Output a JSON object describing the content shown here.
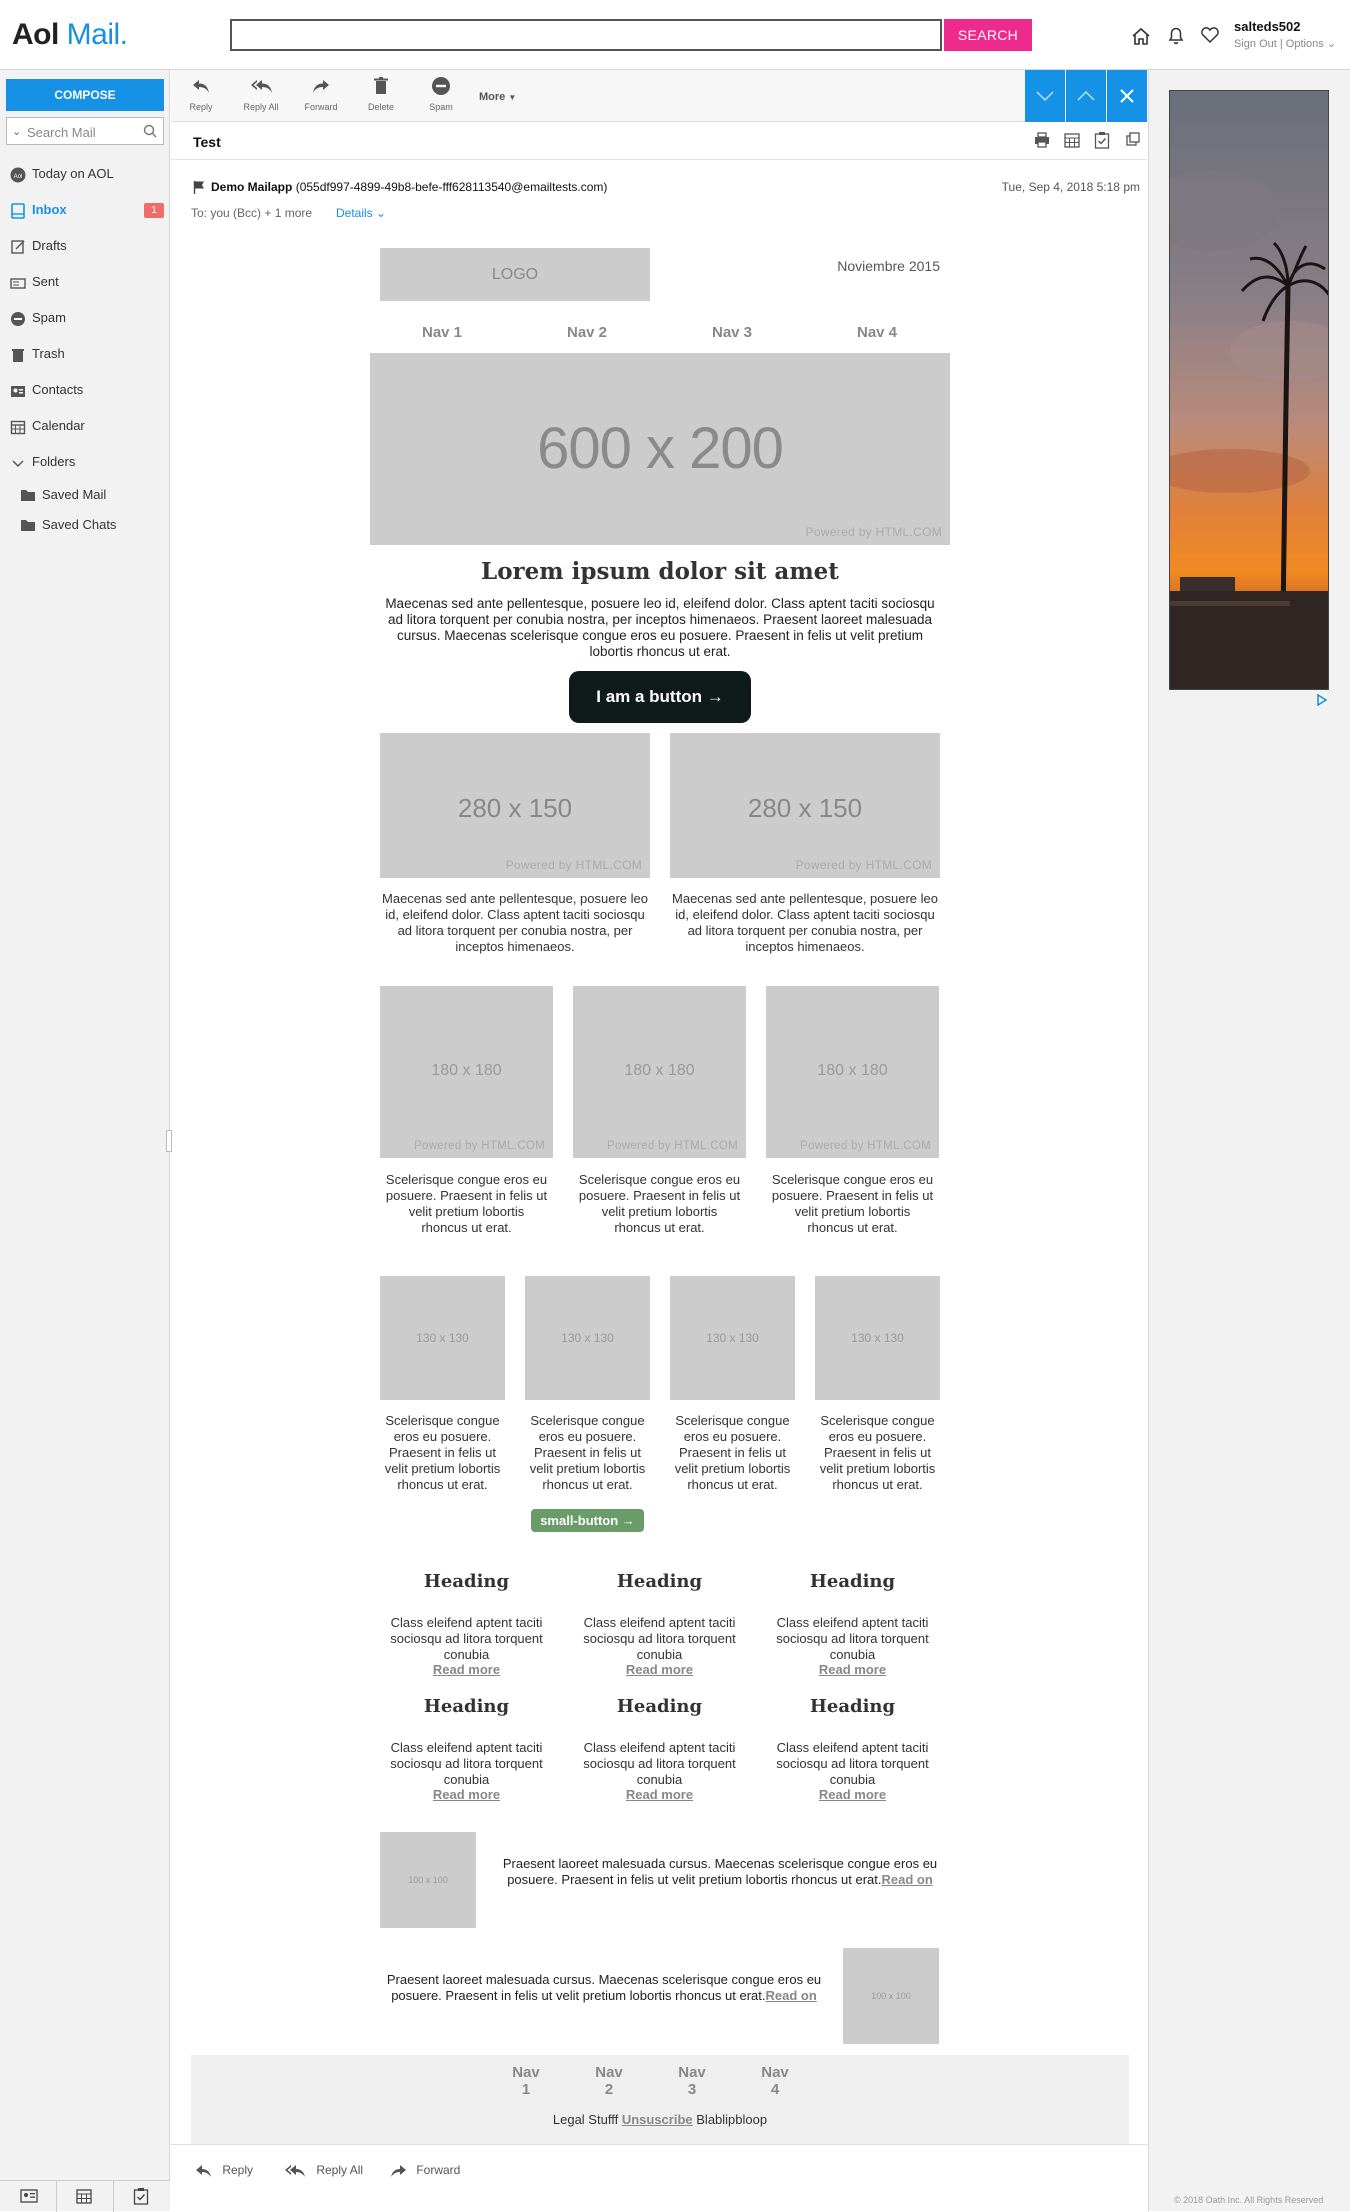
{
  "app": {
    "logo_brand": "Aol",
    "logo_product": "Mail.",
    "search_placeholder": "",
    "search_button": "SEARCH",
    "user_name": "salteds502",
    "sign_out": "Sign Out",
    "options": "Options"
  },
  "sidebar": {
    "compose": "COMPOSE",
    "search_placeholder": "Search Mail",
    "items": [
      {
        "label": "Today on AOL"
      },
      {
        "label": "Inbox",
        "badge": "1"
      },
      {
        "label": "Drafts"
      },
      {
        "label": "Sent"
      },
      {
        "label": "Spam"
      },
      {
        "label": "Trash"
      },
      {
        "label": "Contacts"
      },
      {
        "label": "Calendar"
      },
      {
        "label": "Folders"
      }
    ],
    "folders": [
      {
        "label": "Saved Mail"
      },
      {
        "label": "Saved Chats"
      }
    ]
  },
  "toolbar": {
    "reply": "Reply",
    "reply_all": "Reply All",
    "forward": "Forward",
    "delete": "Delete",
    "spam": "Spam",
    "more": "More"
  },
  "message": {
    "subject": "Test",
    "from_name": "Demo Mailapp",
    "from_address": "(055df997-4899-49b8-befe-fff628113540@emailtests.com)",
    "to": "To: you (Bcc) + 1 more",
    "details": "Details",
    "date": "Tue, Sep 4, 2018 5:18 pm"
  },
  "email": {
    "logo": "LOGO",
    "date": "Noviembre 2015",
    "nav": [
      "Nav 1",
      "Nav 2",
      "Nav 3",
      "Nav 4"
    ],
    "hero": "600 x 200",
    "powered": "Powered by HTML.COM",
    "title": "Lorem ipsum dolor sit amet",
    "intro": "Maecenas sed ante pellentesque, posuere leo id, eleifend dolor. Class aptent taciti sociosqu ad litora torquent per conubia nostra, per inceptos himenaeos. Praesent laoreet malesuada cursus. Maecenas scelerisque congue eros eu posuere. Praesent in felis ut velit pretium lobortis rhoncus ut erat.",
    "button": "I am a button →",
    "two_col": {
      "img": "280 x 150",
      "text": "Maecenas sed ante pellentesque, posuere leo id, eleifend dolor. Class aptent taciti sociosqu ad litora torquent per conubia nostra, per inceptos himenaeos."
    },
    "three_col": {
      "img": "180 x 180",
      "text": "Scelerisque congue eros eu posuere. Praesent in felis ut velit pretium lobortis rhoncus ut erat."
    },
    "four_col": {
      "img": "130 x 130",
      "text": "Scelerisque congue eros eu posuere. Praesent in felis ut velit pretium lobortis rhoncus ut erat."
    },
    "small_button": "small-button →",
    "heading": "Heading",
    "heading_text": "Class eleifend aptent taciti sociosqu ad litora torquent conubia",
    "read_more": "Read more",
    "img_small": "100 x 100",
    "side_text": "Praesent laoreet malesuada cursus. Maecenas scelerisque congue eros eu posuere. Praesent in felis ut velit pretium lobortis rhoncus ut erat.",
    "read_on": "Read on",
    "footer_nav": [
      "Nav 1",
      "Nav 2",
      "Nav 3",
      "Nav 4"
    ],
    "legal": "Legal Stufff",
    "unsubscribe": "Unsuscribe",
    "blab": "Blablipbloop"
  },
  "bottom_actions": {
    "reply": "Reply",
    "reply_all": "Reply All",
    "forward": "Forward"
  },
  "right": {
    "copyright": "© 2018 Oath Inc. All Rights Reserved"
  },
  "colors": {
    "accent": "#1592e6",
    "search_button": "#ee2b8c",
    "badge": "#f26b6b",
    "placeholder": "#cccccc",
    "small_button": "#6a9c6a"
  }
}
